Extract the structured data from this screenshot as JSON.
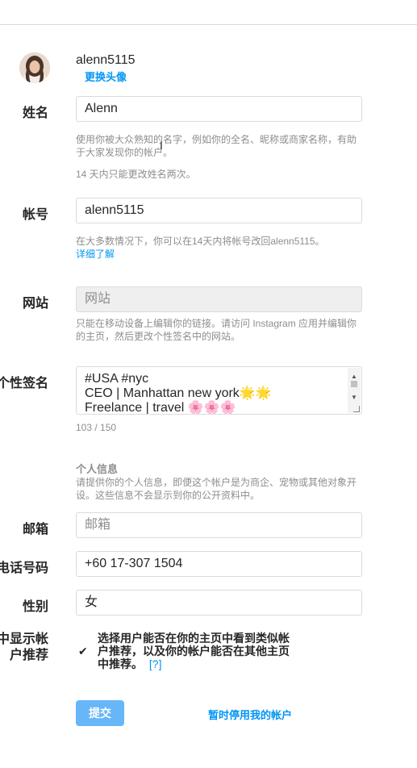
{
  "profile": {
    "username": "alenn5115",
    "change_photo": "更换头像"
  },
  "name": {
    "label": "姓名",
    "value": "Alenn",
    "help": "使用你被大众熟知的名字，例如你的全名、昵称或商家名称，有助于大家发现你的帐户。",
    "limit": "14 天内只能更改姓名两次。"
  },
  "account": {
    "label": "帐号",
    "value": "alenn5115",
    "help": "在大多数情况下，你可以在14天内将帐号改回alenn5115。",
    "learn_more": "详细了解"
  },
  "website": {
    "label": "网站",
    "placeholder": "网站",
    "help": "只能在移动设备上编辑你的链接。请访问 Instagram 应用并编辑你的主页，然后更改个性签名中的网站。"
  },
  "bio": {
    "label": "个性签名",
    "line1": "#USA #nyc",
    "line2": "CEO | Manhattan new york🌟🌟",
    "line3": "Freelance | travel 🌸🌸🌸",
    "counter": "103 / 150"
  },
  "personal": {
    "title": "个人信息",
    "help": "请提供你的个人信息，即便这个帐户是为商企、宠物或其他对象开设。这些信息不会显示到你的公开资料中。"
  },
  "email": {
    "label": "邮箱",
    "placeholder": "邮箱"
  },
  "phone": {
    "label": "电话号码",
    "value": "+60 17-307 1504"
  },
  "gender": {
    "label": "性别",
    "value": "女"
  },
  "suggestions": {
    "label_line1": "中显示帐",
    "label_line2": "户推荐",
    "checked": true,
    "check_mark": "✔",
    "text": "选择用户能否在你的主页中看到类似帐户推荐，以及你的帐户能否在其他主页中推荐。",
    "help_link": "[?]"
  },
  "actions": {
    "submit": "提交",
    "disable": "暂时停用我的帐户"
  },
  "colors": {
    "accent": "#0095f6",
    "submit_bg": "#67b6f8"
  }
}
